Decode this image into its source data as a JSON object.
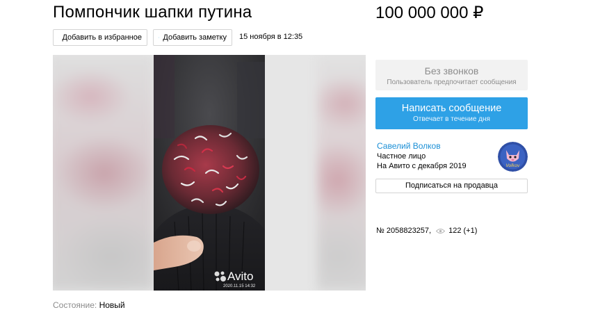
{
  "listing": {
    "title": "Помпончик шапки путина",
    "price": "100 000 000 ₽",
    "date": "15 ноября в 12:35",
    "condition_label": "Состояние:",
    "condition_value": "Новый",
    "number": "№ 2058823257,",
    "views": "122 (+1)"
  },
  "actions": {
    "favorite_label": "Добавить в избранное",
    "note_label": "Добавить заметку"
  },
  "photo": {
    "watermark": "Avito",
    "watermark_date": "2020.11.15 14:32"
  },
  "contact": {
    "no_calls_title": "Без звонков",
    "no_calls_subtitle": "Пользователь предпочитает сообщения",
    "message_button": "Написать сообщение",
    "message_subtitle": "Отвечает в течение дня"
  },
  "seller": {
    "name": "Савелий Волков",
    "type": "Частное лицо",
    "since": "На Авито с декабря 2019",
    "subscribe_label": "Подписаться на продавца",
    "avatar_text": "Volkov"
  },
  "colors": {
    "accent": "#2ea1e6",
    "link": "#1a8fd6",
    "muted": "#8c8c8c"
  },
  "icons": [
    "heart-icon",
    "note-icon",
    "eye-icon",
    "avito-logo-icon"
  ]
}
